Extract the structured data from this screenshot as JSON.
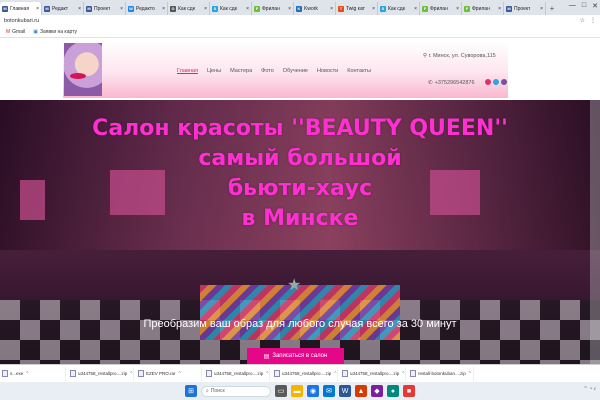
{
  "browser": {
    "tabs": [
      {
        "label": "Главная",
        "fav": "M",
        "color": "#3b5998",
        "active": true
      },
      {
        "label": "Редакт",
        "fav": "M",
        "color": "#3b5998"
      },
      {
        "label": "Проект",
        "fav": "M",
        "color": "#3b5998"
      },
      {
        "label": "Редакто",
        "fav": "W",
        "color": "#1e88e5"
      },
      {
        "label": "Как сде",
        "fav": "G",
        "color": "#555555"
      },
      {
        "label": "Как сде",
        "fav": "S",
        "color": "#29a3e0"
      },
      {
        "label": "Фрилан",
        "fav": "F",
        "color": "#6bbf3a"
      },
      {
        "label": "Kwork",
        "fav": "K",
        "color": "#1f6fb5"
      },
      {
        "label": "Twig кат",
        "fav": "T",
        "color": "#e64a19"
      },
      {
        "label": "Как сде",
        "fav": "S",
        "color": "#29a3e0"
      },
      {
        "label": "Фрилан",
        "fav": "F",
        "color": "#6bbf3a"
      },
      {
        "label": "Фрилан",
        "fav": "F",
        "color": "#6bbf3a"
      },
      {
        "label": "Проект",
        "fav": "M",
        "color": "#3b5998"
      }
    ],
    "new_tab": "+",
    "window_controls": [
      "—",
      "□",
      "✕"
    ],
    "url": "botonkubari.ru",
    "bookmarks": [
      {
        "label": "Gmail",
        "icon": "gmail-icon"
      },
      {
        "label": "Заявки на карту",
        "icon": "bookmark-icon"
      }
    ]
  },
  "site": {
    "nav": [
      "Главная",
      "Цены",
      "Мастера",
      "Фото",
      "Обучение",
      "Новости",
      "Контакты"
    ],
    "address": "г. Минск, ул. Суворова,115",
    "phone": "+375296542876",
    "social": [
      "#e1306c",
      "#2ca5e0",
      "#7b519d"
    ]
  },
  "hero": {
    "headline_lines": [
      "Салон красоты ''BEAUTY QUEEN''",
      "самый большой",
      "бьюти-хаус",
      "в Минске"
    ],
    "subline": "Преобразим ваш образ для любого случая всего за 30 минут",
    "cta": "Записаться в салон",
    "headline_color": "#ff2fd2",
    "cta_color": "#e6068a"
  },
  "downloads": [
    "s...exe",
    "u344758_restallpro....zip",
    "EZEV PRO.rar",
    "u344758_restallpro....zip",
    "u344758_restallpro....zip",
    "u344758_restallpro....zip",
    "restall-botonkuban....zip"
  ],
  "taskbar": {
    "search_placeholder": "Поиск"
  }
}
